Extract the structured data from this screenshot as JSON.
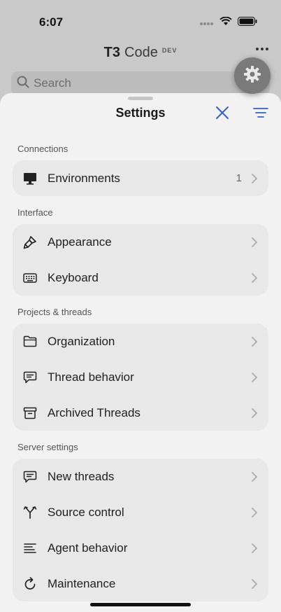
{
  "status": {
    "time": "6:07"
  },
  "app": {
    "brand": "T3",
    "name": "Code",
    "badge": "DEV"
  },
  "search": {
    "placeholder": "Search"
  },
  "sheet": {
    "title": "Settings"
  },
  "sections": [
    {
      "label": "Connections",
      "items": [
        {
          "label": "Environments",
          "count": "1",
          "icon": "monitor-icon"
        }
      ]
    },
    {
      "label": "Interface",
      "items": [
        {
          "label": "Appearance",
          "icon": "brush-icon"
        },
        {
          "label": "Keyboard",
          "icon": "keyboard-icon"
        }
      ]
    },
    {
      "label": "Projects & threads",
      "items": [
        {
          "label": "Organization",
          "icon": "folder-icon"
        },
        {
          "label": "Thread behavior",
          "icon": "message-icon"
        },
        {
          "label": "Archived Threads",
          "icon": "archive-icon"
        }
      ]
    },
    {
      "label": "Server settings",
      "items": [
        {
          "label": "New threads",
          "icon": "message-icon"
        },
        {
          "label": "Source control",
          "icon": "git-branch-icon"
        },
        {
          "label": "Agent behavior",
          "icon": "lines-icon"
        },
        {
          "label": "Maintenance",
          "icon": "refresh-icon"
        }
      ]
    }
  ],
  "colors": {
    "accent": "#2f5fd0",
    "sheet_bg": "#f2f2f2",
    "group_bg": "#e8e8e8"
  }
}
